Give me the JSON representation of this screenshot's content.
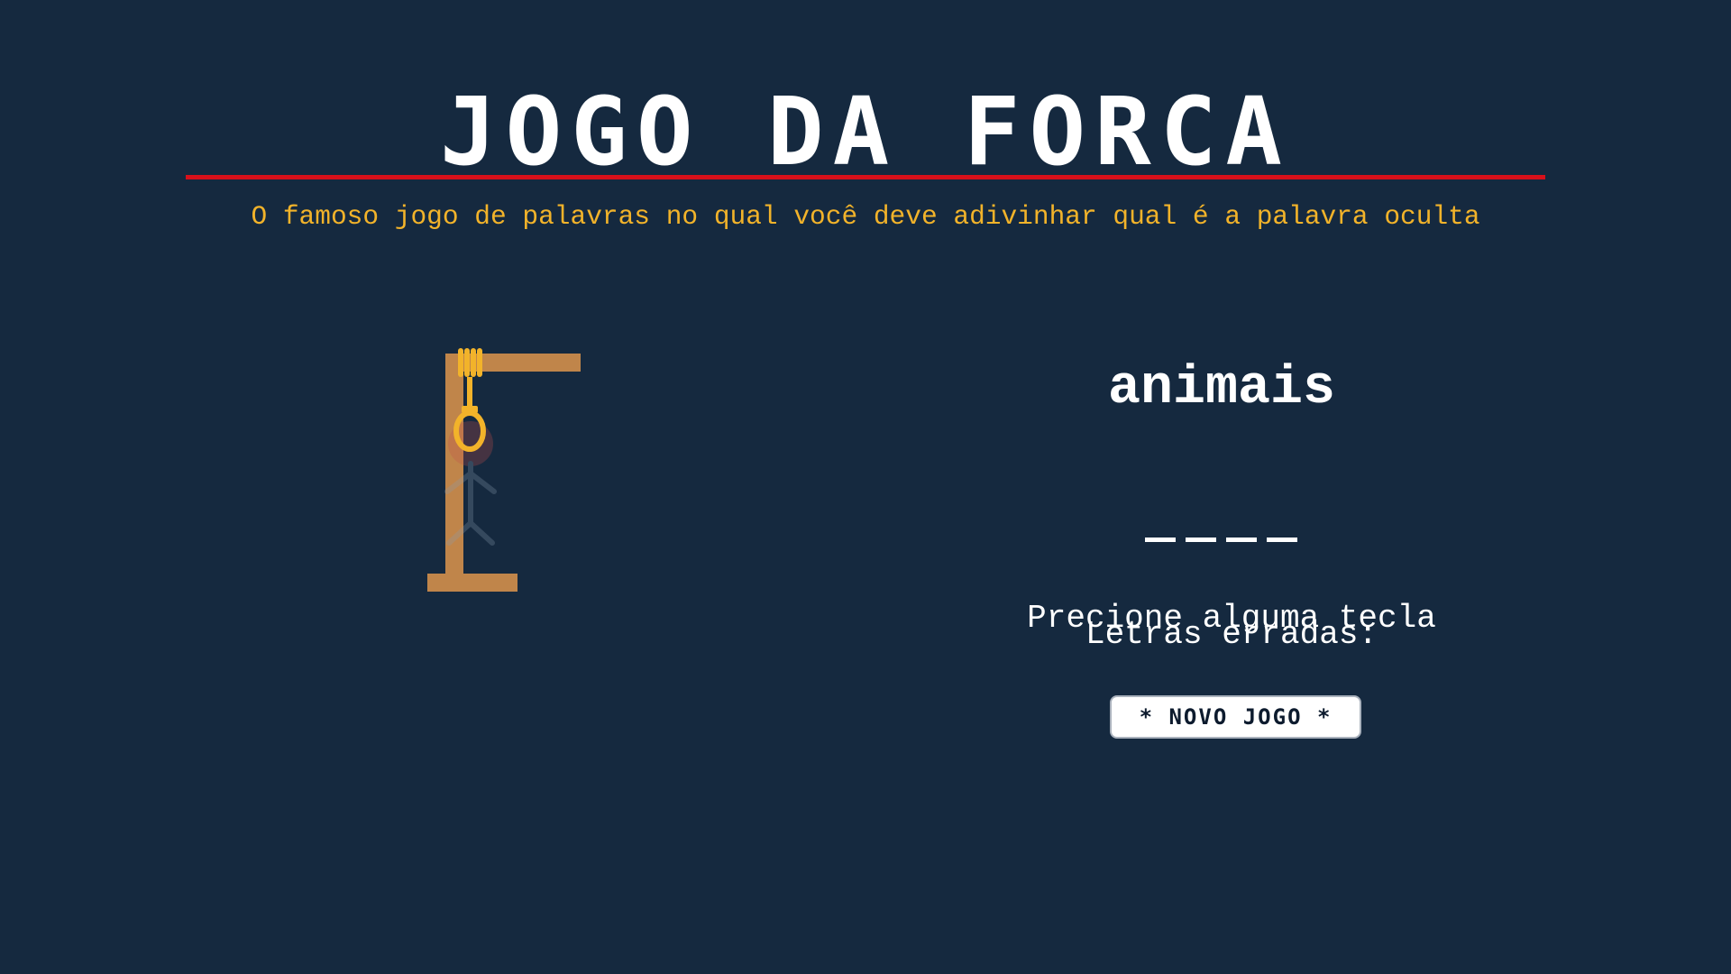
{
  "header": {
    "title": "JOGO DA FORCA",
    "subtitle": "O famoso jogo de palavras no qual você deve adivinhar qual é a palavra oculta"
  },
  "game": {
    "category": "animais",
    "word_length": 4,
    "prompt": "Precione alguma tecla",
    "wrong_letters_label": "Letras erradas:",
    "new_game_label": "* NOVO JOGO *"
  },
  "colors": {
    "background": "#15293f",
    "accent_rule": "#d8101a",
    "subtitle": "#f2b32a",
    "gallows_wood": "#c0854a",
    "rope": "#f2b32a"
  },
  "icons": [
    "gallows-icon",
    "noose-icon",
    "hangman-figure-icon"
  ]
}
